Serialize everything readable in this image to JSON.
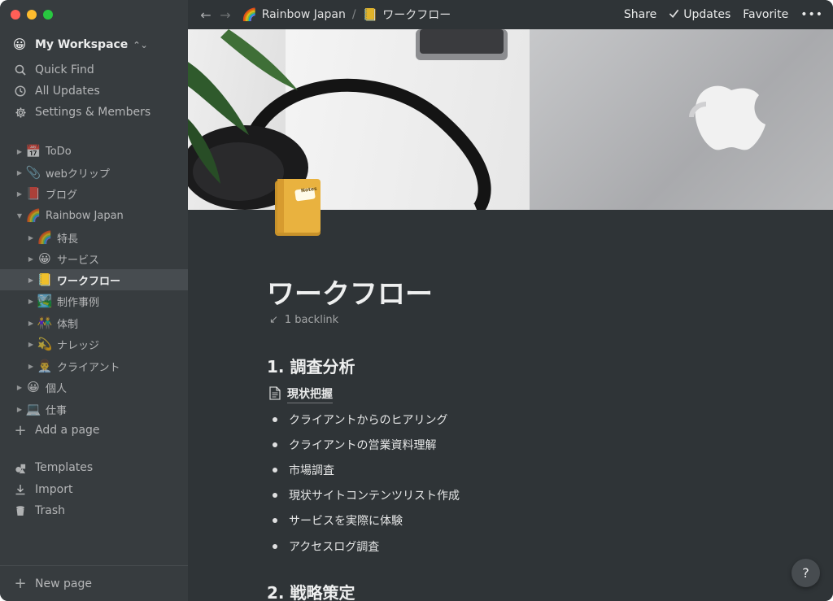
{
  "window": {
    "title": "ワークフロー"
  },
  "sidebar": {
    "workspace": {
      "emoji": "😀",
      "name": "My Workspace"
    },
    "nav": [
      {
        "label": "Quick Find",
        "icon": "search-icon"
      },
      {
        "label": "All Updates",
        "icon": "clock-icon"
      },
      {
        "label": "Settings & Members",
        "icon": "gear-icon"
      }
    ],
    "pages": [
      {
        "emoji": "📅",
        "label": "ToDo",
        "level": 1,
        "expanded": false
      },
      {
        "emoji": "📎",
        "label": "webクリップ",
        "level": 1,
        "expanded": false
      },
      {
        "emoji": "📕",
        "label": "ブログ",
        "level": 1,
        "expanded": false
      },
      {
        "emoji": "🌈",
        "label": "Rainbow Japan",
        "level": 1,
        "expanded": true
      },
      {
        "emoji": "🌈",
        "label": "特長",
        "level": 2,
        "expanded": false
      },
      {
        "emoji": "😀",
        "label": "サービス",
        "level": 2,
        "expanded": false
      },
      {
        "emoji": "📒",
        "label": "ワークフロー",
        "level": 2,
        "expanded": false,
        "active": true
      },
      {
        "emoji": "🏞️",
        "label": "制作事例",
        "level": 2,
        "expanded": false
      },
      {
        "emoji": "👫",
        "label": "体制",
        "level": 2,
        "expanded": false
      },
      {
        "emoji": "💫",
        "label": "ナレッジ",
        "level": 2,
        "expanded": false
      },
      {
        "emoji": "👨‍💼",
        "label": "クライアント",
        "level": 2,
        "expanded": false
      },
      {
        "emoji": "😀",
        "label": "個人",
        "level": 1,
        "expanded": false
      },
      {
        "emoji": "💻",
        "label": "仕事",
        "level": 1,
        "expanded": false
      }
    ],
    "add_page": "Add a page",
    "bottom": [
      {
        "label": "Templates",
        "icon": "templates-icon"
      },
      {
        "label": "Import",
        "icon": "import-icon"
      },
      {
        "label": "Trash",
        "icon": "trash-icon"
      }
    ],
    "new_page": "New page"
  },
  "topbar": {
    "breadcrumb": [
      {
        "emoji": "🌈",
        "label": "Rainbow Japan"
      },
      {
        "emoji": "📒",
        "label": "ワークフロー"
      }
    ],
    "separator": "/",
    "share": "Share",
    "updates": "Updates",
    "favorite": "Favorite",
    "more": "•••"
  },
  "page": {
    "title": "ワークフロー",
    "backlink": "1 backlink",
    "sections": [
      {
        "heading": "1. 調査分析",
        "subpage": "現状把握",
        "bullets": [
          "クライアントからのヒアリング",
          "クライアントの営業資料理解",
          "市場調査",
          "現状サイトコンテンツリスト作成",
          "サービスを実際に体験",
          "アクセスログ調査"
        ]
      },
      {
        "heading": "2. 戦略策定"
      }
    ],
    "icon_label": "Notes"
  },
  "help": "?"
}
